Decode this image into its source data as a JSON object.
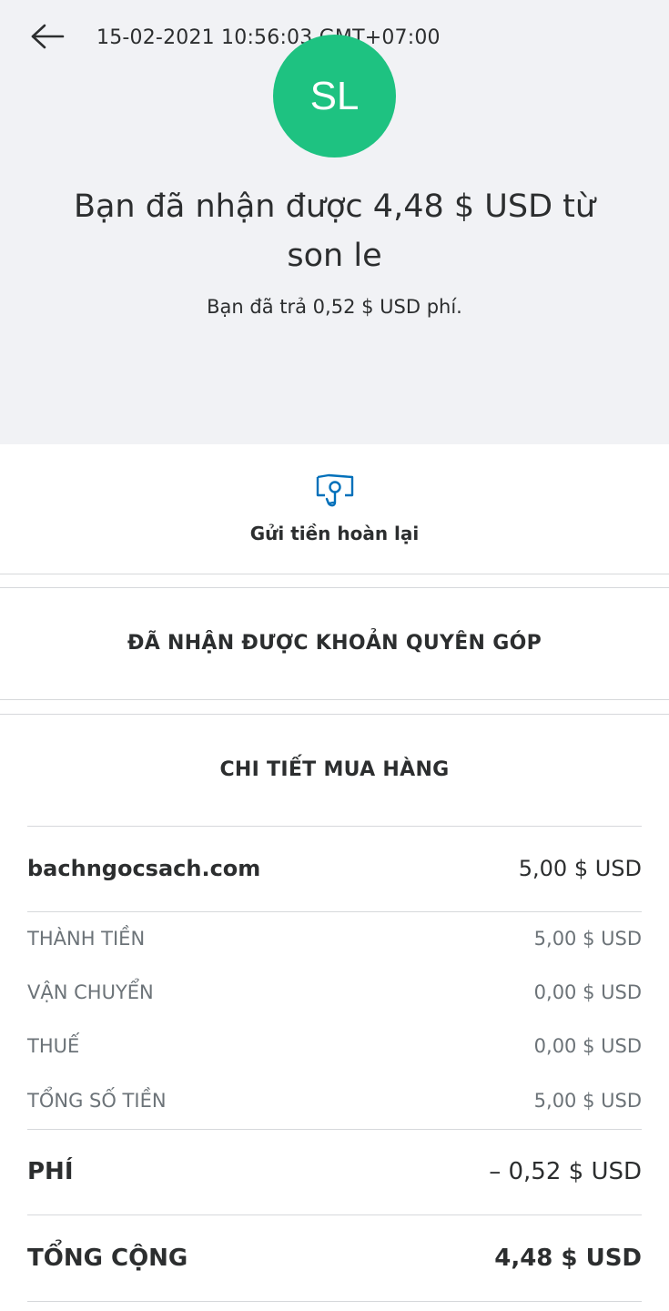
{
  "header": {
    "timestamp": "15-02-2021 10:56:03 GMT+07:00",
    "avatar_initials": "SL",
    "avatar_color": "#1ec281",
    "headline_line1": "Bạn đã nhận được 4,48 $ USD từ",
    "headline_line2": "son le",
    "fee_note": "Bạn đã trả 0,52 $ USD phí."
  },
  "icons": {
    "back": "arrow-left-icon",
    "refund": "refund-money-icon"
  },
  "actions": {
    "refund_label": "Gửi tiền hoàn lại"
  },
  "donation": {
    "title": "ĐÃ NHẬN ĐƯỢC KHOẢN QUYÊN GÓP"
  },
  "purchase": {
    "title": "CHI TIẾT MUA HÀNG",
    "merchant": {
      "label": "bachngocsach.com",
      "value": "5,00 $ USD"
    },
    "lines": [
      {
        "label": "THÀNH TIỀN",
        "value": "5,00 $ USD"
      },
      {
        "label": "VẬN CHUYỂN",
        "value": "0,00 $ USD"
      },
      {
        "label": "THUẾ",
        "value": "0,00 $ USD"
      },
      {
        "label": "TỔNG SỐ TIỀN",
        "value": "5,00 $ USD"
      }
    ],
    "fee": {
      "label": "PHÍ",
      "value": "– 0,52 $ USD"
    },
    "total": {
      "label": "TỔNG CỘNG",
      "value": "4,48 $ USD"
    }
  }
}
